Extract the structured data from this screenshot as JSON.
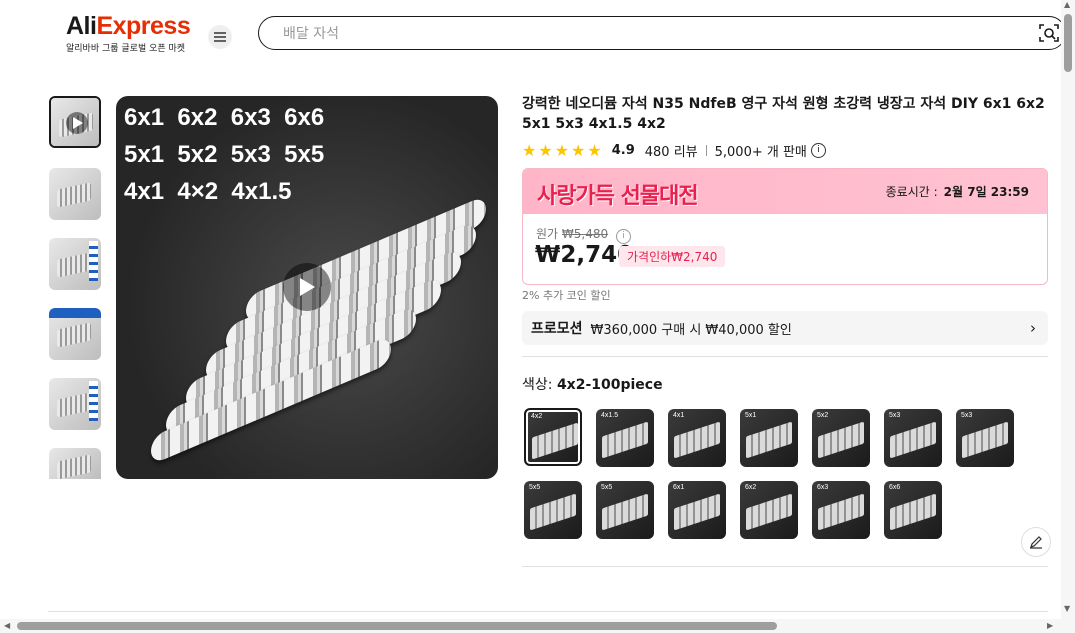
{
  "header": {
    "logo_prefix": "Ali",
    "logo_suffix": "Express",
    "tagline": "알리바바 그룹 글로벌 오픈 마켓",
    "search_placeholder": "배달 자석"
  },
  "gallery": {
    "main_image_rows": [
      "6x1  6x2  6x3  6x6",
      "5x1  5x2  5x3  5x5",
      "4x1  4×2  4x1.5"
    ],
    "thumbnail_count": 6,
    "selected_thumbnail_index": 0
  },
  "product": {
    "title": "강력한 네오디뮴 자석 N35 NdfeB 영구 자석 원형 초강력 냉장고 자석 DIY 6x1 6x2 5x1 5x3 4x1.5 4x2",
    "rating": "4.9",
    "reviews": "480 리뷰",
    "sold": "5,000+ 개 판매",
    "stars": "★★★★★"
  },
  "promotion": {
    "event_name": "사랑가득 선물대전",
    "ends_label": "종료시간 :",
    "ends_value": "2월 7일 23:59",
    "original_label": "원가",
    "original_price": "₩5,480",
    "price": "₩2,740",
    "discount_badge": "가격인하₩2,740",
    "coin_note": "2% 추가 코인 할인",
    "promo_label": "프로모션",
    "promo_text": "₩360,000 구매 시 ₩40,000 할인"
  },
  "variants": {
    "label": "색상:",
    "selected": "4x2-100piece",
    "options": [
      "4x2",
      "4x1.5",
      "4x1",
      "5x1",
      "5x2",
      "5x3",
      "5x3",
      "5x5",
      "5x5",
      "6x1",
      "6x2",
      "6x3",
      "6x6"
    ],
    "selected_index": 0
  },
  "colors": {
    "accent": "#e62e04",
    "promo_pink": "#ffb5c8",
    "promo_red": "#e8214f",
    "star": "#fdc500"
  }
}
